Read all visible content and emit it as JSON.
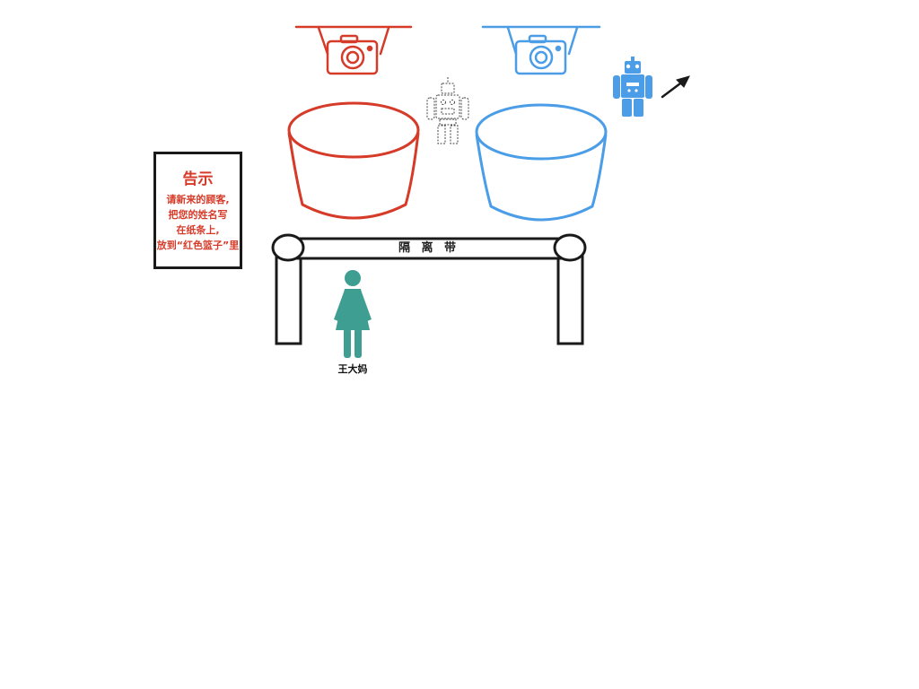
{
  "colors": {
    "red": "#d63a28",
    "blue": "#4a9de6",
    "teal": "#3f9e92",
    "ink": "#1a1a1a",
    "robot_outline": "#444444"
  },
  "notice": {
    "title": "告示",
    "lines": [
      "请新来的顾客,",
      "把您的姓名写",
      "在纸条上,",
      "放到“红色篮子”里"
    ]
  },
  "barrier": {
    "label": "隔 离 带"
  },
  "person": {
    "name": "王大妈"
  },
  "icons": {
    "red_camera": "camera-icon",
    "blue_camera": "camera-icon",
    "outline_robot": "robot-icon",
    "blue_robot": "robot-icon",
    "arrow": "arrow-icon",
    "person": "woman-icon"
  }
}
